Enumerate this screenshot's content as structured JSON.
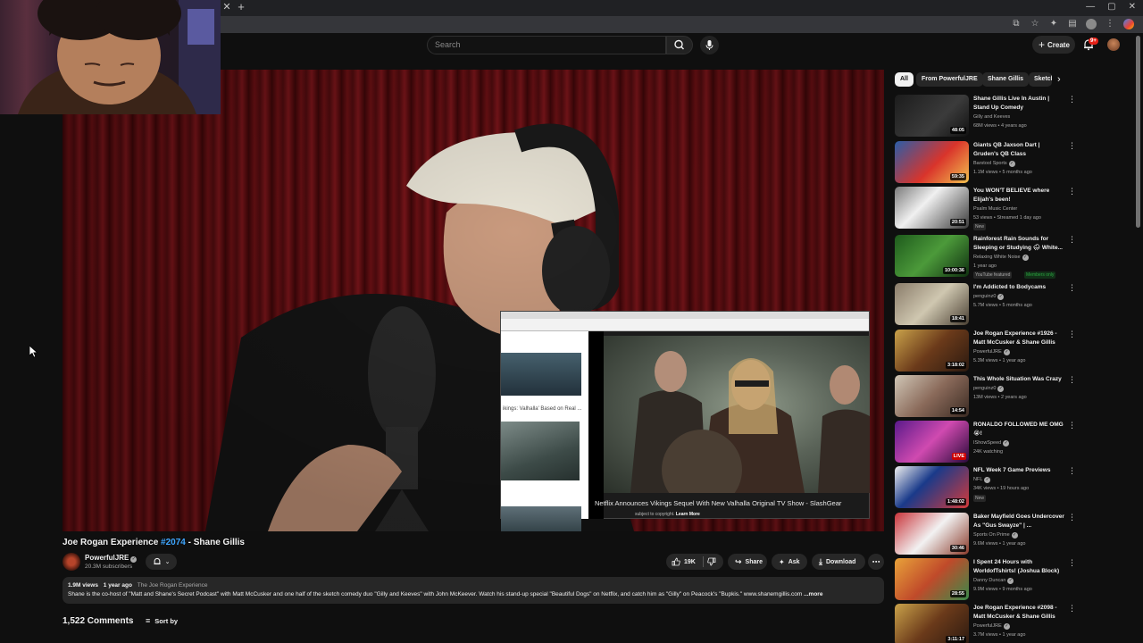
{
  "browser": {
    "close_tab_glyph": "✕",
    "new_tab_glyph": "+",
    "window_controls": [
      "—",
      "▢",
      "✕"
    ]
  },
  "header": {
    "search_placeholder": "Search",
    "create_label": "Create",
    "notification_count": "9+"
  },
  "pip": {
    "sidebar_text": "ikings: Valhalla' Based on Real ...",
    "title": "Netflix Announces Vikings Sequel With New Valhalla Original TV Show - SlashGear",
    "subtitle_text": "subject to copyright.",
    "subtitle_link": "Learn More"
  },
  "video": {
    "title_prefix": "Joe Rogan Experience ",
    "title_hashtag": "#2074",
    "title_suffix": " - Shane Gillis",
    "channel_name": "PowerfulJRE",
    "subscribers": "20.3M subscribers",
    "like_count": "19K",
    "share_label": "Share",
    "ask_label": "Ask",
    "download_label": "Download"
  },
  "description": {
    "views": "1.9M views",
    "age": "1 year ago",
    "tag": "The Joe Rogan Experience",
    "text": "Shane is the co-host of \"Matt and Shane's Secret Podcast\" with Matt McCusker and one half of the sketch comedy duo \"Gilly and Keeves\" with John McKeever. Watch his stand-up special \"Beautiful Dogs\" on Netflix, and catch him as \"Gilly\" on Peacock's \"Bupkis.\" www.shanemgillis.com",
    "more_label": "...more"
  },
  "comments": {
    "count_label": "1,522 Comments",
    "sort_label": "Sort by"
  },
  "chips": [
    "All",
    "From PowerfulJRE",
    "Shane Gillis",
    "Sketch"
  ],
  "recommendations": [
    {
      "title": "Shane Gillis Live In Austin | Stand Up Comedy",
      "channel": "Gilly and Keeves",
      "meta": "68M views • 4 years ago",
      "duration": "48:05",
      "verified": false
    },
    {
      "title": "Giants QB Jaxson Dart | Gruden's QB Class",
      "channel": "Barstool Sports",
      "meta": "1.1M views • 5 months ago",
      "duration": "59:35",
      "verified": true
    },
    {
      "title": "You WON'T BELIEVE where Elijah's been!",
      "channel": "Psalm Music Center",
      "meta": "53 views • Streamed 1 day ago",
      "duration": "20:51",
      "badge": "New",
      "verified": false
    },
    {
      "title": "Rainforest Rain Sounds for Sleeping or Studying 🌧 White...",
      "channel": "Relaxing White Noise",
      "meta": "1 year ago",
      "duration": "10:00:36",
      "badge": "YouTube featured",
      "badge2": "Members only",
      "verified": true
    },
    {
      "title": "I'm Addicted to Bodycams",
      "channel": "penguinz0",
      "meta": "5.7M views • 5 months ago",
      "duration": "18:41",
      "verified": true
    },
    {
      "title": "Joe Rogan Experience #1926 - Matt McCusker & Shane Gillis",
      "channel": "PowerfulJRE",
      "meta": "5.3M views • 1 year ago",
      "duration": "3:18:02",
      "verified": true
    },
    {
      "title": "This Whole Situation Was Crazy",
      "channel": "penguinz0",
      "meta": "13M views • 2 years ago",
      "duration": "14:54",
      "verified": true
    },
    {
      "title": "RONALDO FOLLOWED ME OMG 😭!",
      "channel": "IShowSpeed",
      "meta": "24K watching",
      "duration": "LIVE",
      "live": true,
      "verified": true
    },
    {
      "title": "NFL Week 7 Game Previews",
      "channel": "NFL",
      "meta": "34K views • 19 hours ago",
      "duration": "1:48:02",
      "badge": "New",
      "verified": true
    },
    {
      "title": "Baker Mayfield Goes Undercover As \"Gus Swayze\" | ...",
      "channel": "Sports On Prime",
      "meta": "9.6M views • 1 year ago",
      "duration": "30:46",
      "verified": true
    },
    {
      "title": "I Spent 24 Hours with WorldofTshirts! (Joshua Block)",
      "channel": "Danny Duncan",
      "meta": "9.9M views • 9 months ago",
      "duration": "28:55",
      "verified": true
    },
    {
      "title": "Joe Rogan Experience #2098 - Matt McCusker & Shane Gillis",
      "channel": "PowerfulJRE",
      "meta": "3.7M views • 1 year ago",
      "duration": "3:11:17",
      "verified": true
    }
  ],
  "colors": {
    "background": "#0f0f0f",
    "surface": "#272727",
    "text": "#f1f1f1",
    "muted": "#aaaaaa",
    "link": "#3ea6ff",
    "live": "#cc0000"
  }
}
